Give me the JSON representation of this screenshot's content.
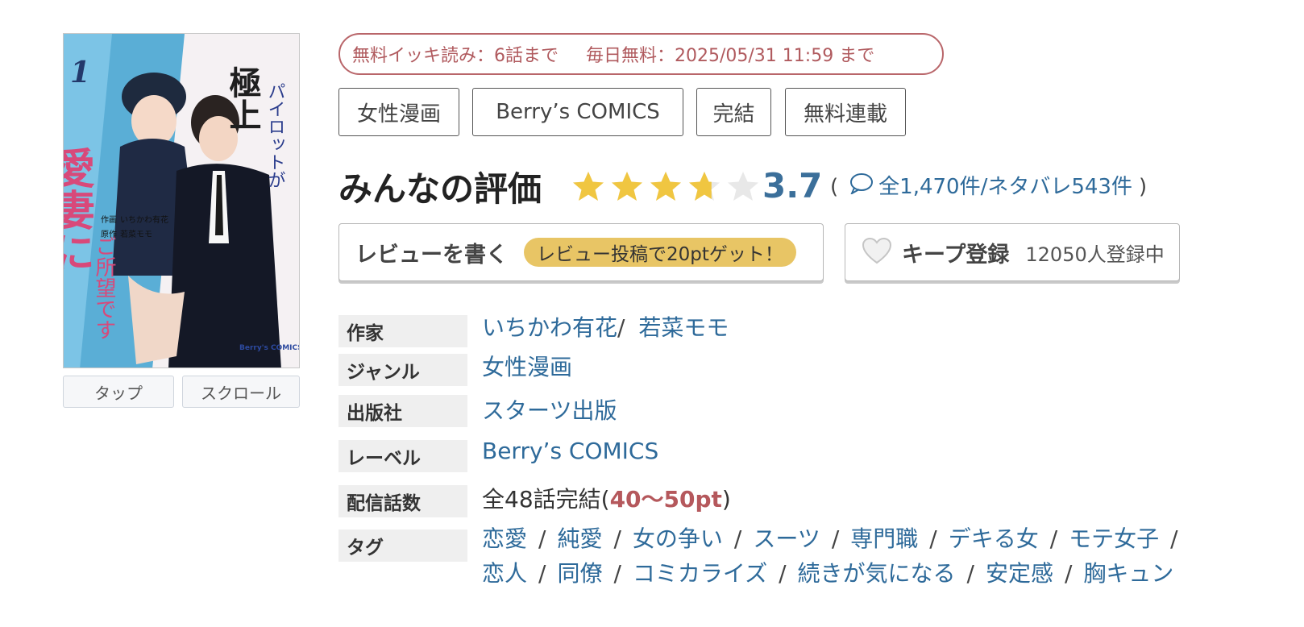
{
  "cover": {
    "title_line1": "極上",
    "title_line2": "パイロットが",
    "title_line3": "愛妻に",
    "title_line4": "ご所望です",
    "volume": "1",
    "credit_label1": "作画",
    "credit_name1": "いちかわ有花",
    "credit_label2": "原作",
    "credit_name2": "若菜モモ",
    "publisher_logo": "Berry's COMICS"
  },
  "view_buttons": {
    "tap": "タップ",
    "scroll": "スクロール"
  },
  "free_info": {
    "binge": "無料イッキ読み：6話まで",
    "daily": "毎日無料：2025/05/31 11:59 まで"
  },
  "tags_top": [
    "女性漫画",
    "Berry’s COMICS",
    "完結",
    "無料連載"
  ],
  "rating": {
    "heading": "みんなの評価",
    "score": "3.7",
    "score_value": 3.7,
    "max": 5,
    "count_text": "全1,470件/ネタバレ543件",
    "open_paren": "(",
    "close_paren": ")"
  },
  "actions": {
    "review_label": "レビューを書く",
    "review_bonus": "レビュー投稿で20ptゲット！",
    "keep_label": "キープ登録",
    "keep_count": "12050人登録中"
  },
  "details": {
    "author_label": "作家",
    "authors": [
      "いちかわ有花",
      "若菜モモ"
    ],
    "author_sep": "/",
    "genre_label": "ジャンル",
    "genre": "女性漫画",
    "publisher_label": "出版社",
    "publisher": "スターツ出版",
    "label_label": "レーベル",
    "label": "Berry’s COMICS",
    "episodes_label": "配信話数",
    "episodes_text": "全48話完結(",
    "episodes_pt": "40〜50pt",
    "episodes_close": ")",
    "tags_label": "タグ",
    "tags_line1": [
      "恋愛",
      "純愛",
      "女の争い",
      "スーツ",
      "専門職",
      "デキる女",
      "モテ女子"
    ],
    "tags_line2": [
      "恋人",
      "同僚",
      "コミカライズ",
      "続きが気になる",
      "安定感",
      "胸キュン"
    ],
    "tag_sep": "/"
  },
  "colors": {
    "link": "#2e6a9a",
    "star": "#f0c641",
    "star_empty": "#e8e8e8",
    "free_border": "#b9666a",
    "bonus_pill": "#e8c565",
    "pt_red": "#b5585c"
  }
}
